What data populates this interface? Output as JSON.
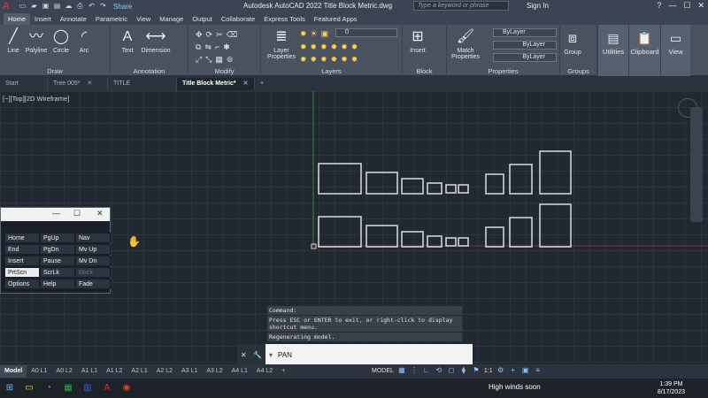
{
  "app": {
    "logo": "A",
    "title": "Autodesk AutoCAD 2022   Title Block Metric.dwg",
    "share": "Share",
    "search_placeholder": "Type a keyword or phrase",
    "sign_in": "Sign In",
    "help": "?"
  },
  "ribbon_tabs": [
    "Home",
    "Insert",
    "Annotate",
    "Parametric",
    "View",
    "Manage",
    "Output",
    "Collaborate",
    "Express Tools",
    "Featured Apps"
  ],
  "ribbon": {
    "draw": {
      "label": "Draw",
      "tools": [
        "Line",
        "Polyline",
        "Circle",
        "Arc"
      ]
    },
    "annotation": {
      "label": "Annotation",
      "tools": [
        "Text",
        "Dimension"
      ]
    },
    "modify": {
      "label": "Modify"
    },
    "layers": {
      "label": "Layers",
      "layer_properties": "Layer Properties",
      "current_layer": "0"
    },
    "block": {
      "label": "Block",
      "insert": "Insert"
    },
    "properties": {
      "label": "Properties",
      "match": "Match Properties",
      "color": "ByLayer",
      "linetype": "ByLayer",
      "lineweight": "ByLayer"
    },
    "groups": {
      "label": "Groups",
      "group": "Group"
    },
    "utilities": "Utilities",
    "clipboard": "Clipboard",
    "view": "View"
  },
  "doc_tabs": [
    "Start",
    "Tree 005*",
    "TITLE BLOCKS*",
    "Title Block Metric*"
  ],
  "viewport_label": "[−][Top][2D Wireframe]",
  "key_popup": {
    "keys": [
      [
        "Home",
        "PgUp",
        "Nav"
      ],
      [
        "End",
        "PgDn",
        "Mv Up"
      ],
      [
        "Insert",
        "Pause",
        "Mv Dn"
      ],
      [
        "PrtScn",
        "ScrLk",
        "Dock"
      ],
      [
        "Options",
        "Help",
        "Fade"
      ]
    ]
  },
  "command_history": [
    "Command:",
    "Press ESC or ENTER to exit, or right-click to display shortcut menu.",
    "Regenerating model."
  ],
  "command_input": "PAN",
  "layout_tabs": [
    "Model",
    "A0 L1",
    "A0 L2",
    "A1 L1",
    "A1 L2",
    "A2 L1",
    "A2 L2",
    "A3 L1",
    "A3 L2",
    "A4 L1",
    "A4 L2"
  ],
  "status": {
    "model": "MODEL",
    "scale": "1:1"
  },
  "taskbar": {
    "weather": "High winds soon",
    "time": "1:39 PM",
    "date": "8/17/2023"
  },
  "colors": {
    "accent": "#3b82c4",
    "canvas": "#212830",
    "ribbon": "#4a5260"
  }
}
